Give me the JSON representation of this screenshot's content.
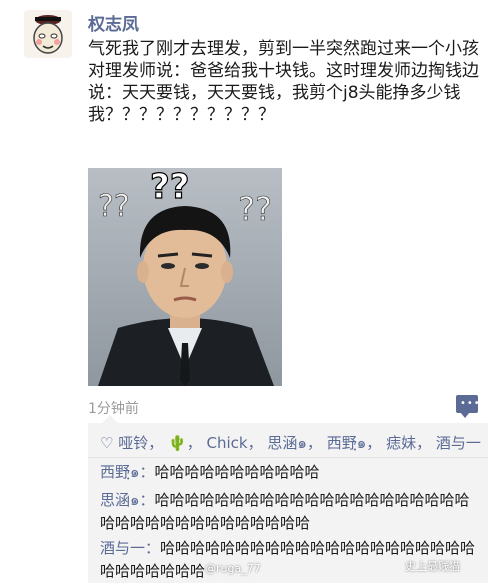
{
  "post": {
    "username": "权志凤",
    "text": "气死我了刚才去理发，剪到一半突然跑过来一个小孩对理发师说：爸爸给我十块钱。这时理发师边掏钱边说：天天要钱，天天要钱，我剪个j8头能挣多少钱\n我？？？？？？？？？？",
    "timestamp": "1分钟前"
  },
  "likes": {
    "names": [
      "哑铃",
      "🌵",
      "Chick",
      "思涵๑",
      "西野ฺ๑",
      "痣妹",
      "酒与一"
    ]
  },
  "comments": [
    {
      "author": "西野ฺ๑",
      "text": "哈哈哈哈哈哈哈哈哈哈哈"
    },
    {
      "author": "思涵๑",
      "text": "哈哈哈哈哈哈哈哈哈哈哈哈哈哈哈哈哈哈哈哈哈哈哈哈哈哈哈哈哈哈哈哈哈哈哈"
    },
    {
      "author": "酒与一",
      "text": "哈哈哈哈哈哈哈哈哈哈哈哈哈哈哈哈哈哈哈哈哈哈哈哈哈哈哈哈"
    }
  ],
  "watermarks": {
    "left": "@ruga_77",
    "right": "史上最贱猫"
  },
  "colors": {
    "link": "#5b6b96",
    "panel_bg": "#f3f3f3",
    "timestamp": "#9b9b9b"
  }
}
